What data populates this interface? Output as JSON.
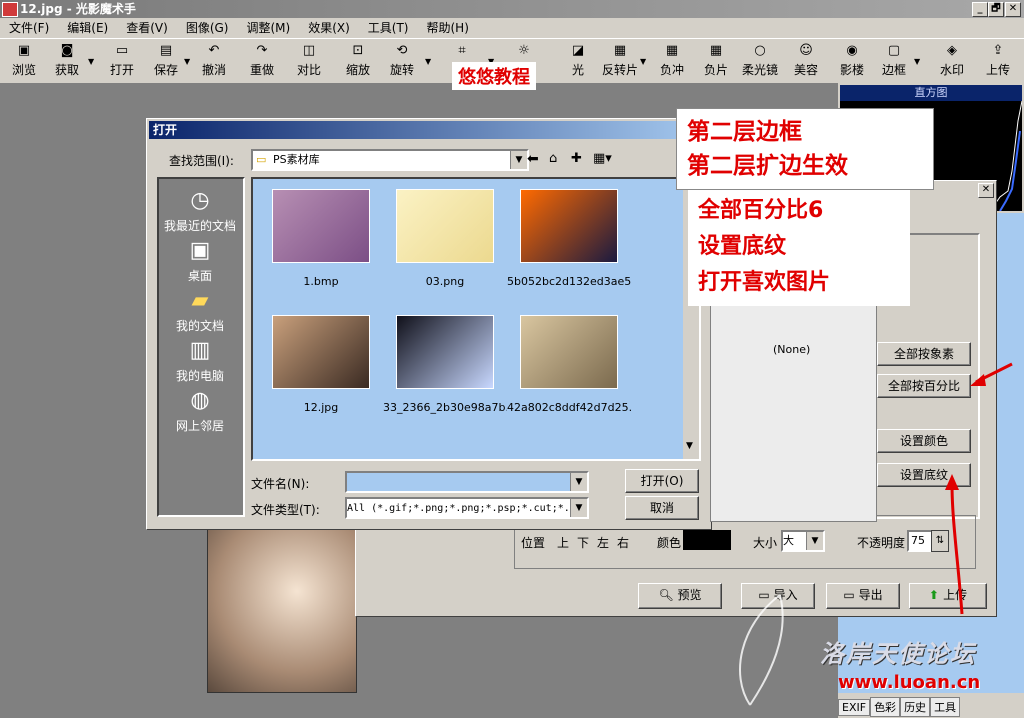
{
  "window": {
    "title": "12.jpg - 光影魔术手",
    "min": "_",
    "restore": "🗗",
    "close": "✕"
  },
  "menu": [
    "文件(F)",
    "编辑(E)",
    "查看(V)",
    "图像(G)",
    "调整(M)",
    "效果(X)",
    "工具(T)",
    "帮助(H)"
  ],
  "toolbar": [
    {
      "label": "浏览",
      "icon": "browse-icon",
      "glyph": "▣"
    },
    {
      "label": "获取",
      "icon": "camera-icon",
      "glyph": "◙"
    },
    {
      "label": "打开",
      "icon": "folder-icon",
      "glyph": "▭"
    },
    {
      "label": "保存",
      "icon": "save-icon",
      "glyph": "▤"
    },
    {
      "label": "撤消",
      "icon": "undo-icon",
      "glyph": "↶"
    },
    {
      "label": "重做",
      "icon": "redo-icon",
      "glyph": "↷"
    },
    {
      "label": "对比",
      "icon": "compare-icon",
      "glyph": "◫"
    },
    {
      "label": "缩放",
      "icon": "zoom-icon",
      "glyph": "⊡"
    },
    {
      "label": "旋转",
      "icon": "rotate-icon",
      "glyph": "⟲"
    },
    {
      "label": "裁",
      "icon": "crop-icon",
      "glyph": "⌗"
    },
    {
      "label": "曝",
      "icon": "exposure-icon",
      "glyph": "☼"
    },
    {
      "label": "光",
      "icon": "light-icon",
      "glyph": "◪"
    },
    {
      "label": "反转片",
      "icon": "reverse-film-icon",
      "glyph": "▦"
    },
    {
      "label": "负冲",
      "icon": "cross-process-icon",
      "glyph": "▦"
    },
    {
      "label": "负片",
      "icon": "negative-icon",
      "glyph": "▦"
    },
    {
      "label": "柔光镜",
      "icon": "soft-light-icon",
      "glyph": "○"
    },
    {
      "label": "美容",
      "icon": "beauty-icon",
      "glyph": "☺"
    },
    {
      "label": "影楼",
      "icon": "studio-icon",
      "glyph": "◉"
    },
    {
      "label": "边框",
      "icon": "frame-icon",
      "glyph": "▢"
    },
    {
      "label": "水印",
      "icon": "watermark-icon",
      "glyph": "◈"
    },
    {
      "label": "上传",
      "icon": "upload-icon",
      "glyph": "⇪"
    }
  ],
  "overlay_brand": "悠悠教程",
  "histogram_title": "直方图",
  "panel_tabs": [
    "EXIF",
    "色彩",
    "历史",
    "工具"
  ],
  "open_dialog": {
    "title": "打开",
    "lookin_label": "查找范围(I):",
    "lookin_value": "PS素材库",
    "places": [
      "我最近的文档",
      "桌面",
      "我的文档",
      "我的电脑",
      "网上邻居"
    ],
    "files": [
      {
        "name": "1.bmp",
        "colors": [
          "#b78fb3",
          "#7c4f86"
        ]
      },
      {
        "name": "03.png",
        "colors": [
          "#fbf2c4",
          "#ecd98f"
        ]
      },
      {
        "name": "5b052bc2d132ed3ae5...",
        "colors": [
          "#ff6a00",
          "#1a1a40"
        ]
      },
      {
        "name": "12.jpg",
        "colors": [
          "#c9a07c",
          "#3a2a22"
        ]
      },
      {
        "name": "33_2366_2b30e98a7b...",
        "colors": [
          "#10101a",
          "#c8d8ff"
        ]
      },
      {
        "name": "42a802c8ddf42d7d25...",
        "colors": [
          "#d9c6a0",
          "#7b6a4e"
        ]
      }
    ],
    "filename_label": "文件名(N):",
    "filename_value": "",
    "filetype_label": "文件类型(T):",
    "filetype_value": "All (*.gif;*.png;*.png;*.psp;*.cut;*.",
    "open_button": "打开(O)",
    "cancel_button": "取消"
  },
  "frame_dialog": {
    "preview_none": "(None)",
    "btn_by_pixel": "全部按象素",
    "btn_by_percent": "全部按百分比",
    "btn_set_color": "设置颜色",
    "btn_set_texture": "设置底纹",
    "position_label": "位置",
    "sides": [
      "上",
      "下",
      "左",
      "右"
    ],
    "color_label": "颜色",
    "size_label": "大小",
    "size_value": "大",
    "opacity_label": "不透明度",
    "opacity_value": "75",
    "preview_button": "预览",
    "import_button": "导入",
    "export_button": "导出",
    "upload_button": "上传"
  },
  "annotations": {
    "box1": [
      "第二层边框",
      "第二层扩边生效"
    ],
    "box2": [
      "全部百分比6",
      "设置底纹",
      "打开喜欢图片"
    ]
  },
  "watermark": {
    "forum": "洛岸天使论坛",
    "url": "www.luoan.cn"
  },
  "colors": {
    "title_blue": "#0a246a",
    "file_area": "#a6caf0",
    "annotation_red": "#e00000"
  }
}
